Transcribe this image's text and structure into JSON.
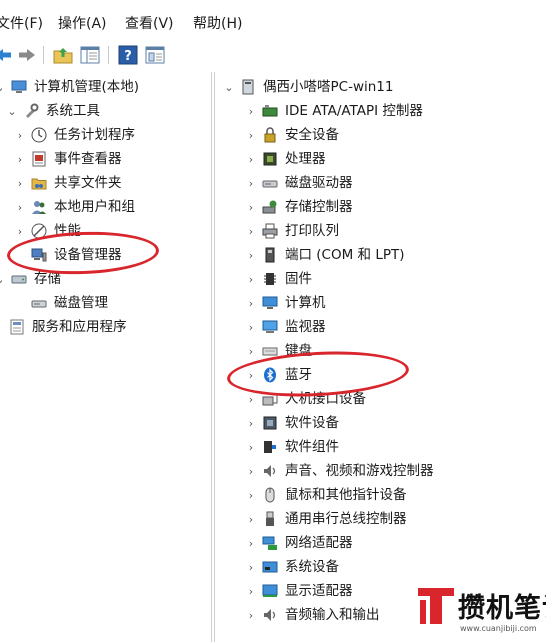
{
  "menubar": {
    "items": [
      "文件(F)",
      "操作(A)",
      "查看(V)",
      "帮助(H)"
    ]
  },
  "toolbar": {
    "buttons": [
      "back-icon",
      "forward-icon",
      "up-folder-icon",
      "show-hide-tree-icon",
      "help-icon",
      "properties-icon"
    ]
  },
  "left_tree": {
    "root": "计算机管理(本地)",
    "system_tools": "系统工具",
    "task_scheduler": "任务计划程序",
    "event_viewer": "事件查看器",
    "shared_folders": "共享文件夹",
    "local_users": "本地用户和组",
    "performance": "性能",
    "device_manager": "设备管理器",
    "storage": "存储",
    "disk_management": "磁盘管理",
    "services": "服务和应用程序"
  },
  "device_tree": {
    "root": "偶西小嗒嗒PC-win11",
    "items": [
      "IDE ATA/ATAPI 控制器",
      "安全设备",
      "处理器",
      "磁盘驱动器",
      "存储控制器",
      "打印队列",
      "端口 (COM 和 LPT)",
      "固件",
      "计算机",
      "监视器",
      "键盘",
      "蓝牙",
      "人机接口设备",
      "软件设备",
      "软件组件",
      "声音、视频和游戏控制器",
      "鼠标和其他指针设备",
      "通用串行总线控制器",
      "网络适配器",
      "系统设备",
      "显示适配器",
      "音频输入和输出"
    ]
  },
  "watermark": {
    "title": "攒机笔记",
    "url": "www.cuanjibiji.com"
  },
  "colors": {
    "highlight_circle": "#d8262c",
    "watermark_red": "#d8262c"
  }
}
